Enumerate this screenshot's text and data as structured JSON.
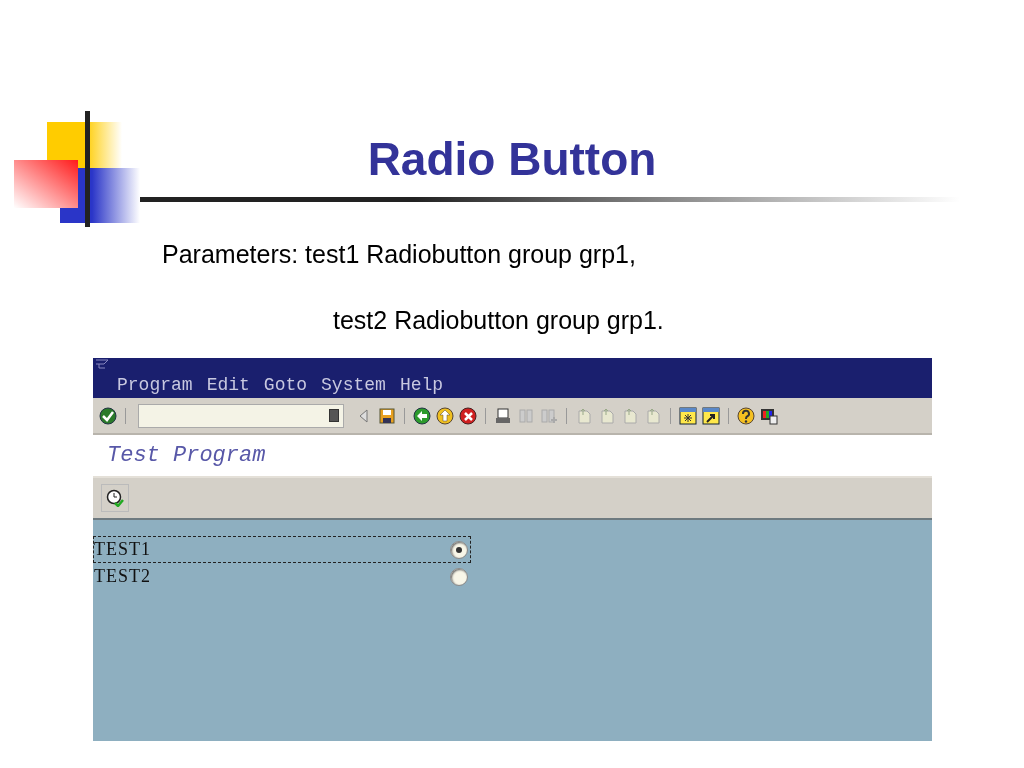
{
  "slide": {
    "title": "Radio Button",
    "parameters": [
      "Parameters: test1 Radiobutton group grp1,",
      "test2 Radiobutton group grp1."
    ]
  },
  "window": {
    "menu": [
      "Program",
      "Edit",
      "Goto",
      "System",
      "Help"
    ],
    "title": "Test Program",
    "radios": [
      {
        "label": "TEST1",
        "selected": true,
        "focused": true
      },
      {
        "label": "TEST2",
        "selected": false,
        "focused": false
      }
    ]
  }
}
